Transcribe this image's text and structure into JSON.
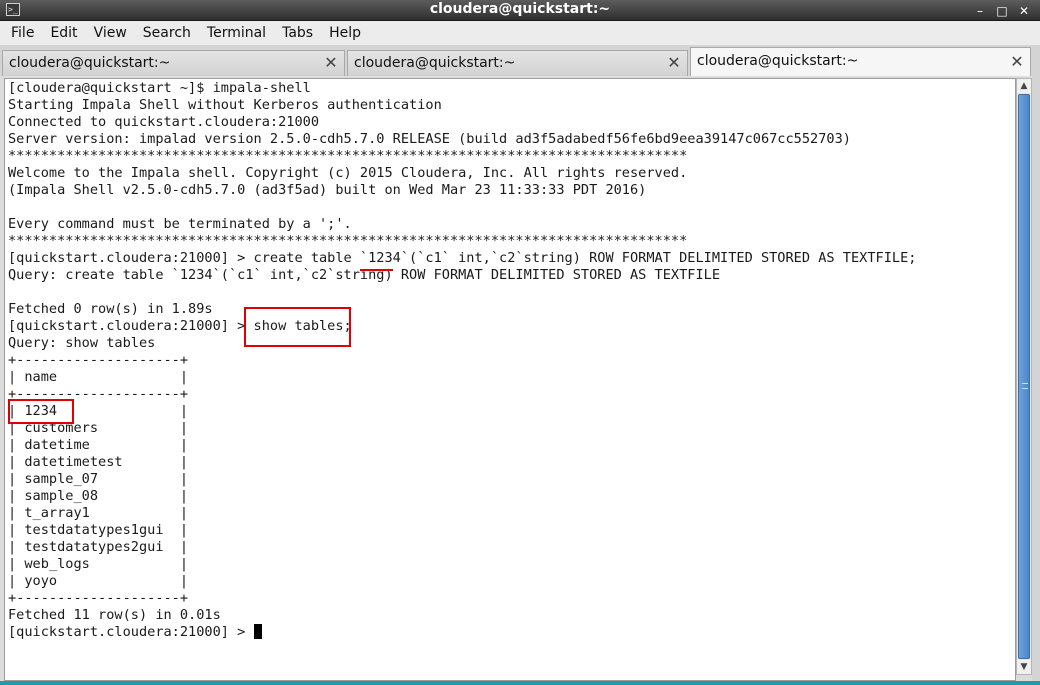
{
  "window": {
    "title": "cloudera@quickstart:~",
    "icon": "terminal-icon",
    "buttons": {
      "minimize": "–",
      "maximize": "□",
      "close": "✕"
    }
  },
  "menu": [
    "File",
    "Edit",
    "View",
    "Search",
    "Terminal",
    "Tabs",
    "Help"
  ],
  "tabs": [
    {
      "label": "cloudera@quickstart:~",
      "active": false
    },
    {
      "label": "cloudera@quickstart:~",
      "active": false
    },
    {
      "label": "cloudera@quickstart:~",
      "active": true
    }
  ],
  "tab_close_glyph": "✕",
  "terminal": {
    "lines": [
      "[cloudera@quickstart ~]$ impala-shell",
      "Starting Impala Shell without Kerberos authentication",
      "Connected to quickstart.cloudera:21000",
      "Server version: impalad version 2.5.0-cdh5.7.0 RELEASE (build ad3f5adabedf56fe6bd9eea39147c067cc552703)",
      "***********************************************************************************",
      "Welcome to the Impala shell. Copyright (c) 2015 Cloudera, Inc. All rights reserved.",
      "(Impala Shell v2.5.0-cdh5.7.0 (ad3f5ad) built on Wed Mar 23 11:33:33 PDT 2016)",
      "",
      "Every command must be terminated by a ';'.",
      "***********************************************************************************",
      "[quickstart.cloudera:21000] > create table `1234`(`c1` int,`c2`string) ROW FORMAT DELIMITED STORED AS TEXTFILE;",
      "Query: create table `1234`(`c1` int,`c2`string) ROW FORMAT DELIMITED STORED AS TEXTFILE",
      "",
      "Fetched 0 row(s) in 1.89s",
      "[quickstart.cloudera:21000] > show tables;",
      "Query: show tables",
      "+--------------------+",
      "| name               |",
      "+--------------------+",
      "| 1234               |",
      "| customers          |",
      "| datetime           |",
      "| datetimetest       |",
      "| sample_07          |",
      "| sample_08          |",
      "| t_array1           |",
      "| testdatatypes1gui  |",
      "| testdatatypes2gui  |",
      "| web_logs           |",
      "| yoyo               |",
      "+--------------------+",
      "Fetched 11 row(s) in 0.01s"
    ],
    "prompt": "[quickstart.cloudera:21000] > "
  },
  "colors": {
    "annotation": "#e00000",
    "scroll_thumb": "#4a86c8"
  }
}
